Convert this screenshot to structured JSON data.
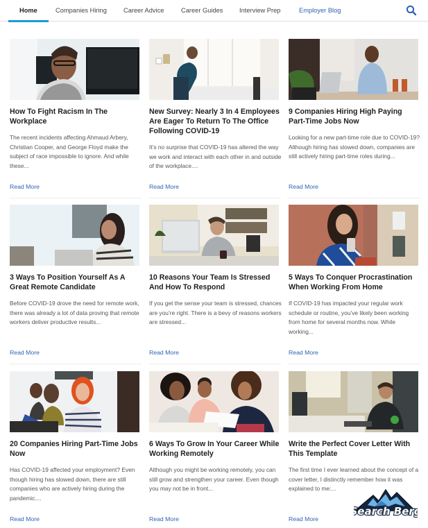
{
  "nav": {
    "items": [
      {
        "label": "Home",
        "active": true
      },
      {
        "label": "Companies Hiring"
      },
      {
        "label": "Career Advice"
      },
      {
        "label": "Career Guides"
      },
      {
        "label": "Interview Prep"
      },
      {
        "label": "Employer Blog",
        "highlight": true
      }
    ],
    "search_icon": "search-icon",
    "accent_color": "#1a9ad6",
    "link_color": "#2f62b4"
  },
  "articles": [
    {
      "title": "How To Fight Racism In The Workplace",
      "excerpt": "The recent incidents affecting Ahmaud Arbery, Christian Cooper, and George Floyd make the subject of race impossible to ignore. And while these...",
      "read_more": "Read More",
      "image": "woman with glasses at office desk"
    },
    {
      "title": "New Survey: Nearly 3 In 4 Employees Are Eager To Return To The Office Following COVID-19",
      "excerpt": "It’s no surprise that COVID-19 has altered the way we work and interact with each other in and outside of the workplace....",
      "read_more": "Read More",
      "image": "woman on phone leaning over desk"
    },
    {
      "title": "9 Companies Hiring High Paying Part-Time Jobs Now",
      "excerpt": "Looking for a new part-time role due to COVID-19? Although hiring has slowed down, companies are still actively hiring part-time roles during...",
      "read_more": "Read More",
      "image": "man on phone at desk with laptop"
    },
    {
      "title": "3 Ways To Position Yourself As A Great Remote Candidate",
      "excerpt": "Before COVID-19 drove the need for remote work, there was already a lot of data proving that remote workers deliver productive results...",
      "read_more": "Read More",
      "image": "woman working on laptop at home"
    },
    {
      "title": "10 Reasons Your Team Is Stressed And How To Respond",
      "excerpt": "If you get the sense your team is stressed, chances are you’re right. There is a bevy of reasons workers are stressed...",
      "read_more": "Read More",
      "image": "man at desktop computer in home office"
    },
    {
      "title": "5 Ways To Conquer Procrastination When Working From Home",
      "excerpt": "If COVID-19 has impacted your regular work schedule or routine, you’ve likely been working from home for several months now. While working...",
      "read_more": "Read More",
      "image": "woman looking at phone on street"
    },
    {
      "title": "20 Companies Hiring Part-Time Jobs Now",
      "excerpt": "Has COVID-19 affected your employment? Even though hiring has slowed down, there are still companies who are actively hiring during the pandemic....",
      "read_more": "Read More",
      "image": "three women smiling at laptop"
    },
    {
      "title": "6 Ways To Grow In Your Career While Working Remotely",
      "excerpt": "Although you might be working remotely, you can still grow and strengthen your career. Even though you may not be in front...",
      "read_more": "Read More",
      "image": "three people reviewing documents"
    },
    {
      "title": "Write the Perfect Cover Letter With This Template",
      "excerpt": "The first time I ever learned about the concept of a cover letter, I distinctly remember how it was explained to me:...",
      "read_more": "Read More",
      "image": "man typing at office computer"
    }
  ],
  "watermark": {
    "text": "Search Berg"
  }
}
